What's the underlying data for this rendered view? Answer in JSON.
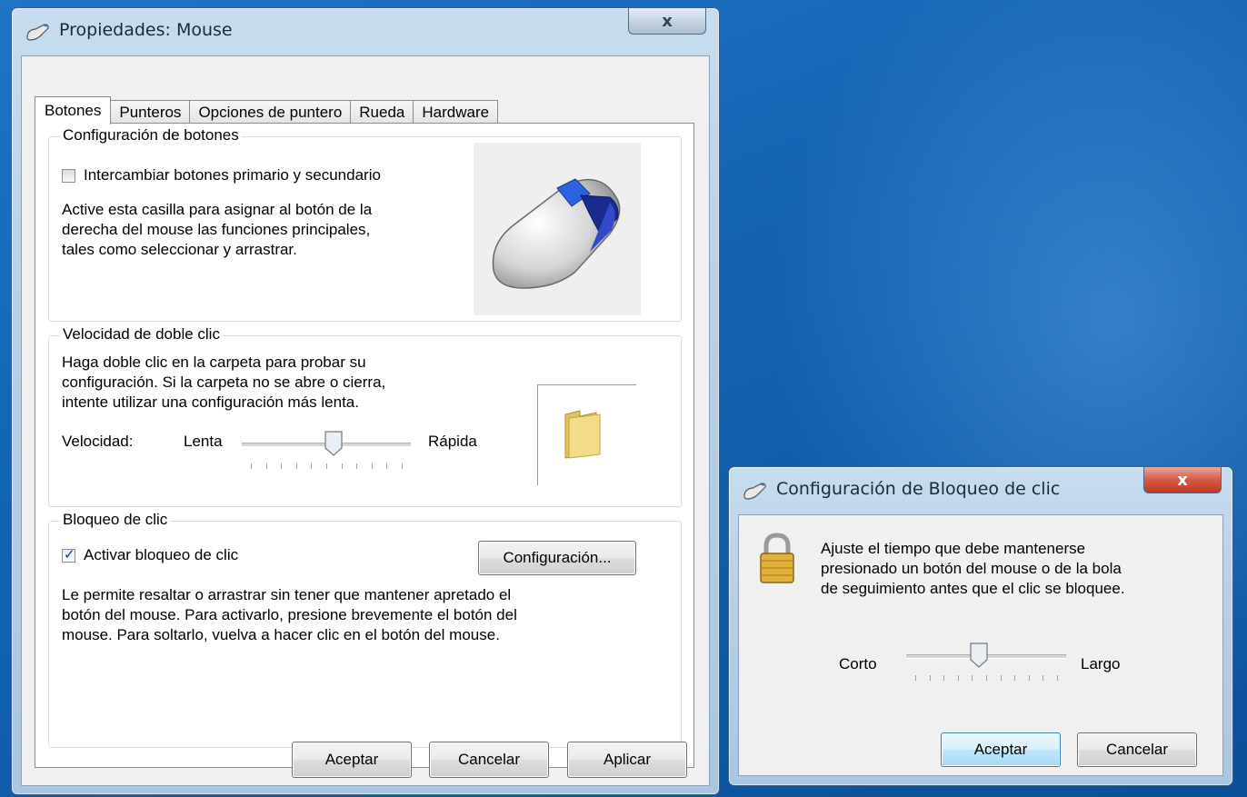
{
  "main_window": {
    "title": "Propiedades: Mouse",
    "close_label": "x",
    "tabs": [
      {
        "label": "Botones",
        "active": true
      },
      {
        "label": "Punteros",
        "active": false
      },
      {
        "label": "Opciones de puntero",
        "active": false
      },
      {
        "label": "Rueda",
        "active": false
      },
      {
        "label": "Hardware",
        "active": false
      }
    ],
    "button_config": {
      "group_title": "Configuración de botones",
      "swap_label": "Intercambiar botones primario y secundario",
      "swap_checked": false,
      "description_lines": [
        "Active esta casilla para asignar al botón de la",
        "derecha del mouse las funciones principales,",
        "tales como seleccionar y arrastrar."
      ]
    },
    "double_click": {
      "group_title": "Velocidad de doble clic",
      "description_lines": [
        "Haga doble clic en la carpeta para probar su",
        "configuración. Si la carpeta no se abre o cierra,",
        "intente utilizar una configuración más lenta."
      ],
      "speed_label": "Velocidad:",
      "slow_label": "Lenta",
      "fast_label": "Rápida",
      "slider_fraction": 0.55
    },
    "click_lock": {
      "group_title": "Bloqueo de clic",
      "enable_label": "Activar bloqueo de clic",
      "enable_checked": true,
      "settings_button": "Configuración...",
      "description_lines": [
        "Le permite resaltar o arrastrar sin tener que mantener apretado el",
        "botón del mouse. Para activarlo, presione brevemente el botón del",
        "mouse. Para soltarlo, vuelva a hacer clic en el botón del mouse."
      ]
    },
    "buttons": {
      "ok": "Aceptar",
      "cancel": "Cancelar",
      "apply": "Aplicar"
    }
  },
  "clicklock_window": {
    "title": "Configuración de Bloqueo de clic",
    "close_label": "x",
    "description_lines": [
      "Ajuste el tiempo que debe mantenerse",
      "presionado un botón del mouse o de la bola",
      "de seguimiento antes que el clic se bloquee."
    ],
    "short_label": "Corto",
    "long_label": "Largo",
    "slider_fraction": 0.45,
    "buttons": {
      "ok": "Aceptar",
      "cancel": "Cancelar"
    }
  },
  "icons": {
    "title_icon": "mouse-icon",
    "mouse_illustration": "mouse-illustration",
    "folder": "folder-icon",
    "lock": "padlock-icon"
  }
}
